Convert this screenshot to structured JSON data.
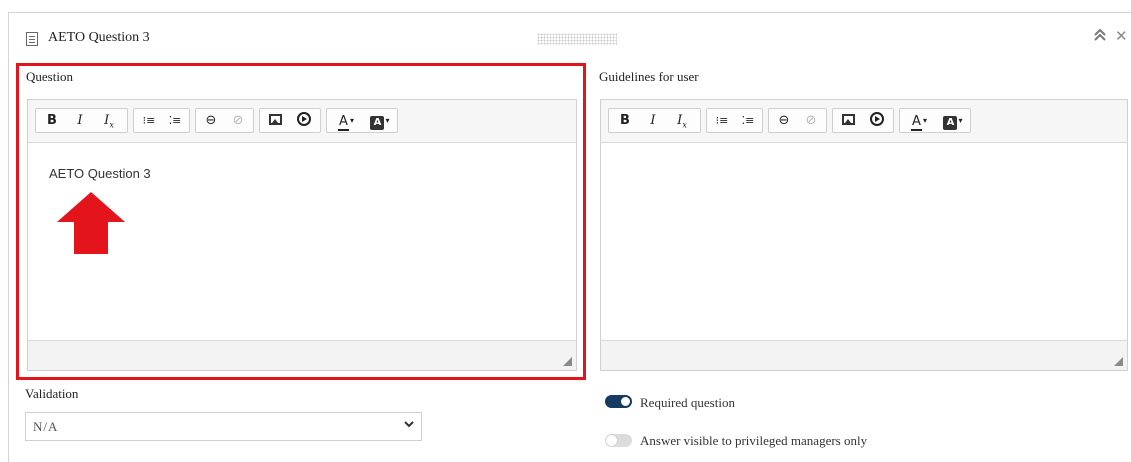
{
  "panel": {
    "title": "AETO Question 3",
    "title_icon": "document-icon",
    "collapse_glyph": "⌃⌃",
    "close_glyph": "✕"
  },
  "question": {
    "label": "Question",
    "content": "AETO Question 3"
  },
  "guidelines": {
    "label": "Guidelines for user",
    "content": ""
  },
  "toolbar": {
    "bold": "B",
    "italic": "I",
    "remove_format": "I",
    "remove_format_sub": "x",
    "numbered_list": "⁝≡",
    "bulleted_list": "⁚≡",
    "link": "⊖",
    "unlink": "⊘",
    "text_color": "A",
    "bg_color": "A",
    "caret": "▾"
  },
  "validation": {
    "label": "Validation",
    "selected": "N/A",
    "chevron": "⌄"
  },
  "options": {
    "required_label": "Required question",
    "required_on": true,
    "privileged_label": "Answer visible to privileged managers only",
    "privileged_on": false
  },
  "colors": {
    "highlight": "#e3141c",
    "toggle_on": "#173a60",
    "toggle_off": "#dcdcdc"
  }
}
